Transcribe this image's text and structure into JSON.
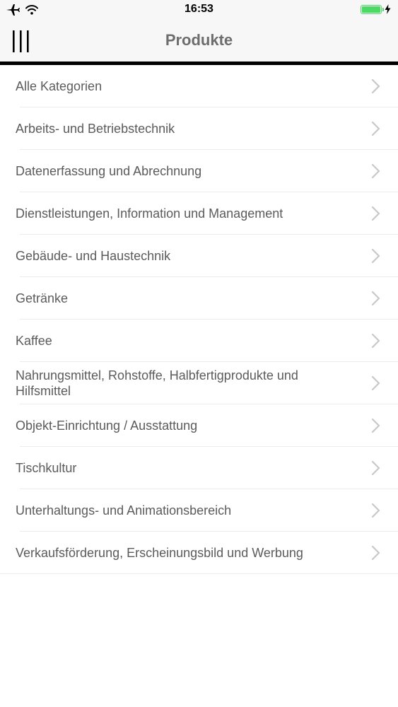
{
  "status_bar": {
    "time": "16:53"
  },
  "nav": {
    "title": "Produkte"
  },
  "categories": [
    {
      "label": "Alle Kategorien"
    },
    {
      "label": "Arbeits- und Betriebstechnik"
    },
    {
      "label": "Datenerfassung und Abrechnung"
    },
    {
      "label": "Dienstleistungen, Information und Management"
    },
    {
      "label": "Gebäude- und Haustechnik"
    },
    {
      "label": "Getränke"
    },
    {
      "label": "Kaffee"
    },
    {
      "label": "Nahrungsmittel, Rohstoffe, Halbfertigprodukte und Hilfsmittel"
    },
    {
      "label": "Objekt-Einrichtung / Ausstattung"
    },
    {
      "label": "Tischkultur"
    },
    {
      "label": "Unterhaltungs- und Animationsbereich"
    },
    {
      "label": "Verkaufsförderung, Erscheinungsbild und Werbung"
    }
  ],
  "icons": {
    "airplane": "airplane-icon",
    "wifi": "wifi-icon",
    "battery": "battery-icon",
    "charging": "charging-bolt-icon",
    "menu": "menu-icon",
    "chevron": "chevron-right-icon"
  },
  "colors": {
    "battery": "#4cd964",
    "nav_background": "#f7f7f7",
    "nav_border": "#000000",
    "label": "#5b5b5b",
    "chevron": "#c7c7cc",
    "separator": "#ececec"
  }
}
